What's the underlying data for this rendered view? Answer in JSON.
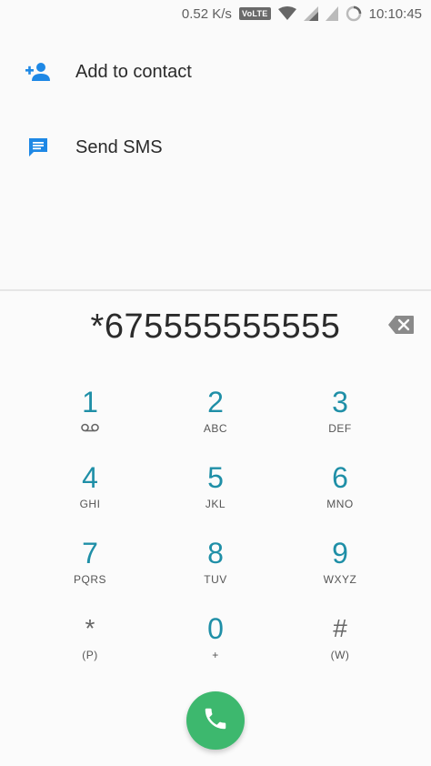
{
  "status_bar": {
    "speed": "0.52 K/s",
    "volte": "VoLTE",
    "time": "10:10:45"
  },
  "suggestions": [
    {
      "label": "Add to contact",
      "icon": "add-person-icon"
    },
    {
      "label": "Send SMS",
      "icon": "message-icon"
    }
  ],
  "dialpad": {
    "digits": "*675555555555",
    "keys": [
      {
        "num": "1",
        "sub": ""
      },
      {
        "num": "2",
        "sub": "ABC"
      },
      {
        "num": "3",
        "sub": "DEF"
      },
      {
        "num": "4",
        "sub": "GHI"
      },
      {
        "num": "5",
        "sub": "JKL"
      },
      {
        "num": "6",
        "sub": "MNO"
      },
      {
        "num": "7",
        "sub": "PQRS"
      },
      {
        "num": "8",
        "sub": "TUV"
      },
      {
        "num": "9",
        "sub": "WXYZ"
      },
      {
        "num": "*",
        "sub": "(P)"
      },
      {
        "num": "0",
        "sub": "+"
      },
      {
        "num": "#",
        "sub": "(W)"
      }
    ]
  },
  "colors": {
    "accent": "#1f8fa7",
    "icon_blue": "#1e88e5",
    "call_green": "#3db86e"
  }
}
